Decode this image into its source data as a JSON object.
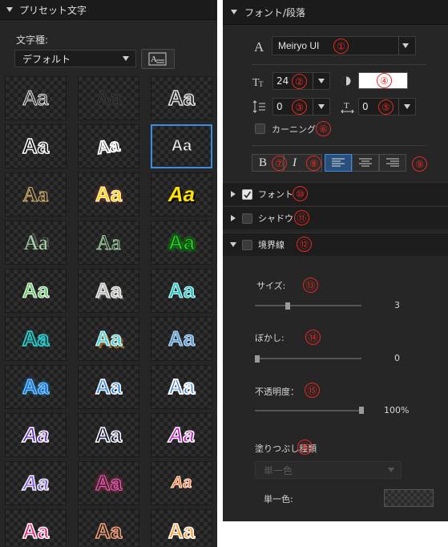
{
  "left_panel": {
    "title": "プリセット文字",
    "font_type_label": "文字種:",
    "font_type_value": "デフォルト",
    "preview_button_icon": "text-preview-icon",
    "presets": [
      {
        "text": "Aa",
        "style": "outline-white-thin"
      },
      {
        "text": "Aa",
        "style": "dark"
      },
      {
        "text": "Aa",
        "style": "outline-white"
      },
      {
        "text": "Aa",
        "style": "black-white-outline"
      },
      {
        "text": "Aa",
        "style": "heavy-outline-tilt"
      },
      {
        "text": "Aa",
        "style": "white-dark-outline-selected"
      },
      {
        "text": "Aa",
        "style": "serif-gold-outline"
      },
      {
        "text": "Aa",
        "style": "yellow-glow"
      },
      {
        "text": "Aa",
        "style": "yellow-italic-black"
      },
      {
        "text": "Aa",
        "style": "serif-green-shadow"
      },
      {
        "text": "Aa",
        "style": "serif-green-outline"
      },
      {
        "text": "Aa",
        "style": "green-bold"
      },
      {
        "text": "Aa",
        "style": "green-white-outline"
      },
      {
        "text": "Aa",
        "style": "grey-3d"
      },
      {
        "text": "Aa",
        "style": "cyan-outline"
      },
      {
        "text": "Aa",
        "style": "teal-outline-heavy"
      },
      {
        "text": "Aa",
        "style": "cyan-3d-shadow"
      },
      {
        "text": "Aa",
        "style": "steel-blue-outline"
      },
      {
        "text": "Aa",
        "style": "blue-glow"
      },
      {
        "text": "Aa",
        "style": "blue-white-outline"
      },
      {
        "text": "Aa",
        "style": "blue-white-heavy"
      },
      {
        "text": "Aa",
        "style": "purple-white-italic"
      },
      {
        "text": "Aa",
        "style": "dark-navy-white"
      },
      {
        "text": "Aa",
        "style": "magenta-white-italic"
      },
      {
        "text": "Aa",
        "style": "violet-white-italic"
      },
      {
        "text": "Aa",
        "style": "plum-glow"
      },
      {
        "text": "Aa",
        "style": "orange-fire-italic"
      },
      {
        "text": "Aa",
        "style": "pink-white"
      },
      {
        "text": "Aa",
        "style": "salmon-outline"
      },
      {
        "text": "Aa",
        "style": "orange-white"
      }
    ]
  },
  "right_panel": {
    "font_section_title": "フォント/段落",
    "font_icon": "A",
    "font_name": "Meiryo UI",
    "font_size": "24",
    "font_size_icon": "font-size-icon",
    "color_icon": "color-contrast-icon",
    "line_spacing": "0",
    "char_spacing": "0",
    "kerning_label": "カーニング",
    "bold_label": "B",
    "italic_label": "I",
    "align_left_icon": "align-left-icon",
    "align_center_icon": "align-center-icon",
    "align_right_icon": "align-right-icon",
    "sections": {
      "font": "フォント",
      "shadow": "シャドウ",
      "border": "境界線"
    },
    "border": {
      "size_label": "サイズ:",
      "size_value": "3",
      "size_fraction": 0.3,
      "blur_label": "ぼかし:",
      "blur_value": "0",
      "blur_fraction": 0.0,
      "opacity_label": "不透明度：",
      "opacity_value": "100%",
      "opacity_fraction": 1.0,
      "fill_type_label": "塗りつぶし種類",
      "fill_type_value": "単一色",
      "single_color_label": "単一色:"
    },
    "annotations": [
      "①",
      "②",
      "③",
      "④",
      "⑤",
      "⑥",
      "⑦",
      "⑧",
      "⑨",
      "⑩",
      "⑪",
      "⑫",
      "⑬",
      "⑭",
      "⑮",
      "⑯"
    ]
  },
  "colors": {
    "panel_bg": "#262626",
    "header_bg": "#1b1b1b",
    "selection_blue": "#3a8de0",
    "annotation_red": "#e8271f"
  }
}
